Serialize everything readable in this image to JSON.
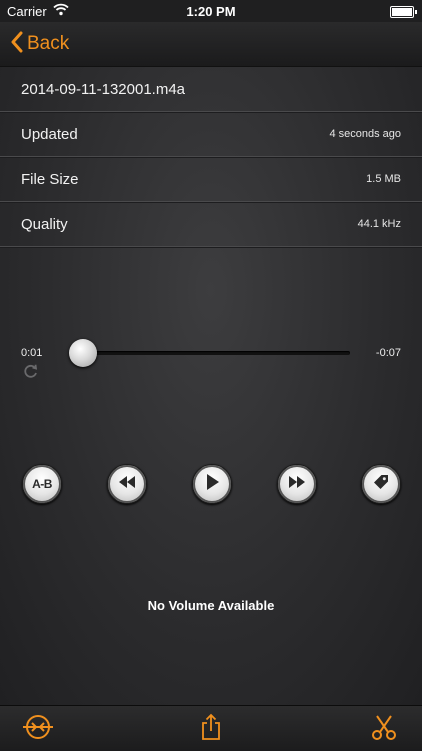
{
  "status_bar": {
    "carrier": "Carrier",
    "time": "1:20 PM"
  },
  "nav": {
    "back_label": "Back"
  },
  "file": {
    "name": "2014-09-11-132001.m4a",
    "details": [
      {
        "label": "Updated",
        "value": "4 seconds ago"
      },
      {
        "label": "File Size",
        "value": "1.5 MB"
      },
      {
        "label": "Quality",
        "value": "44.1 kHz"
      }
    ]
  },
  "player": {
    "elapsed": "0:01",
    "remaining": "-0:07",
    "progress": 0.0,
    "controls": {
      "ab_label": "A-B"
    },
    "volume_message": "No Volume Available"
  },
  "toolbar": {
    "icons": [
      "split-icon",
      "share-icon",
      "scissors-icon"
    ]
  },
  "colors": {
    "accent": "#f0901e"
  }
}
